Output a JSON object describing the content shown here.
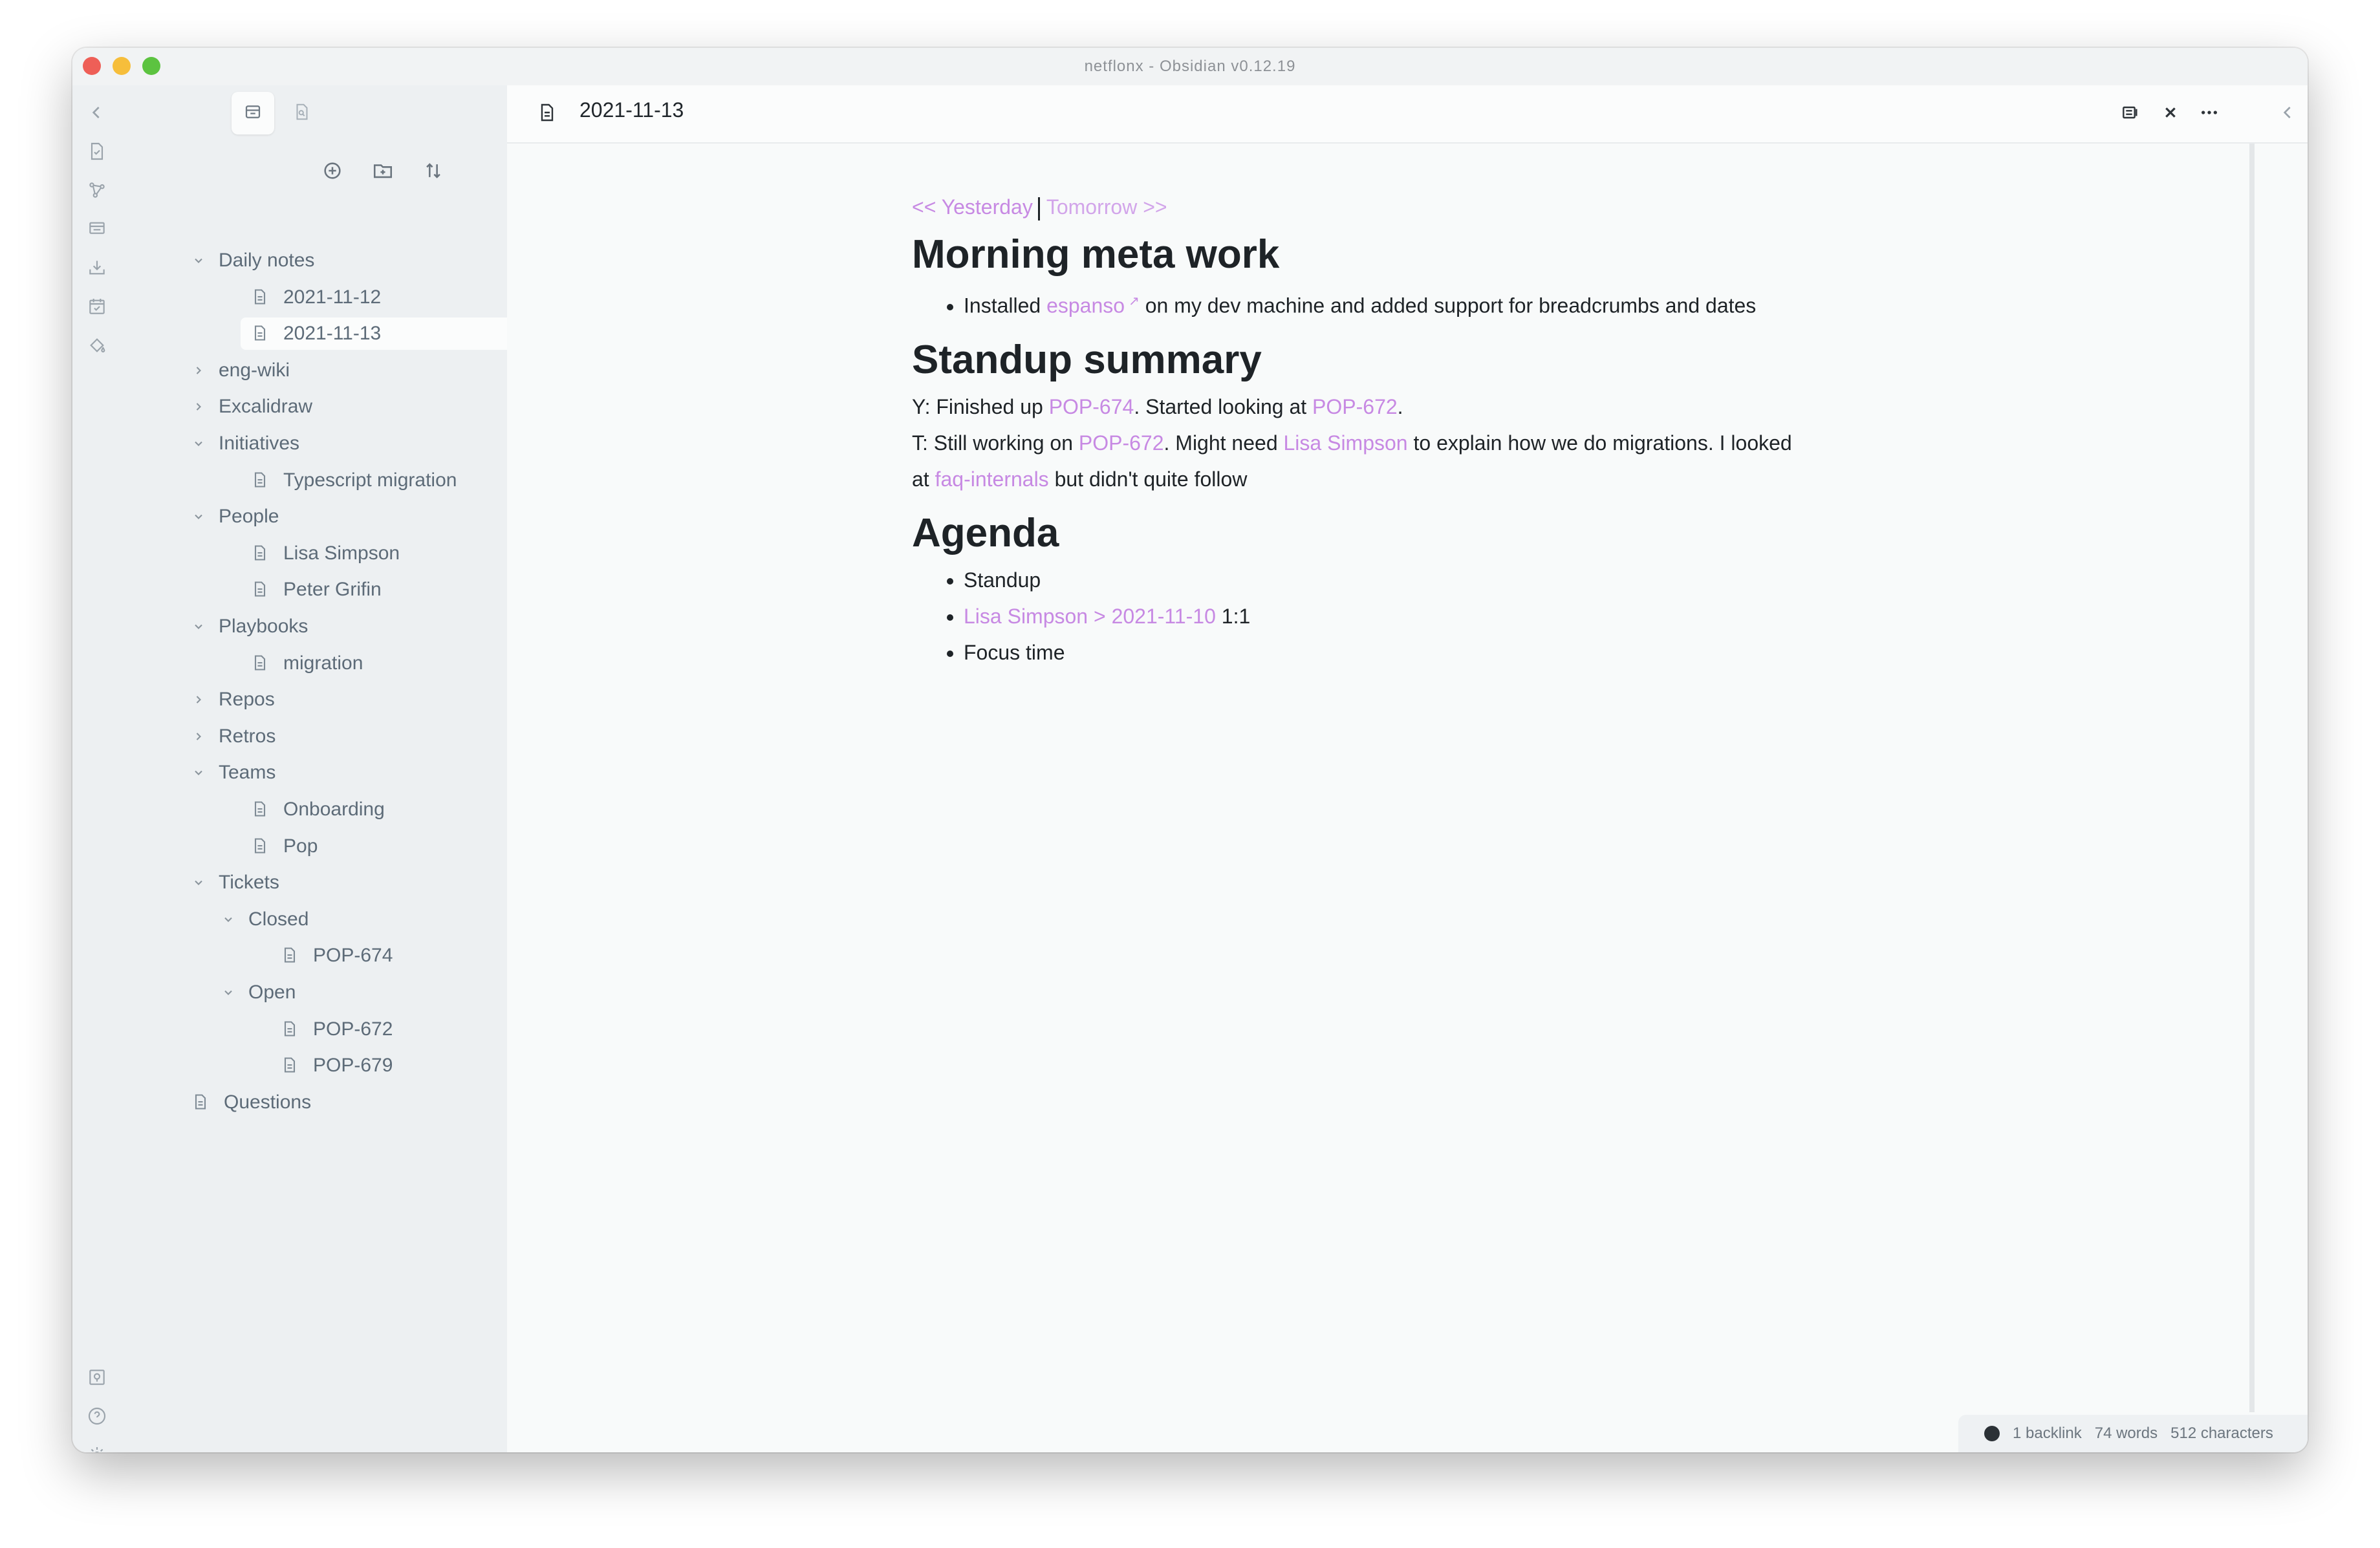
{
  "window": {
    "title": "netflonx - Obsidian v0.12.19"
  },
  "ribbon": {
    "icons": [
      "collapse-left-icon",
      "open-quick-switcher-icon",
      "graph-view-icon",
      "kanban-icon",
      "import-icon",
      "daily-note-icon",
      "paint-bucket-icon",
      "open-vault-icon",
      "help-icon",
      "settings-icon"
    ]
  },
  "sidebar": {
    "tabs": [
      "file-explorer-icon",
      "search-icon"
    ],
    "nav_actions": [
      "new-note-icon",
      "new-folder-icon",
      "sort-icon"
    ],
    "tree": [
      {
        "label": "Daily notes",
        "type": "folder",
        "expanded": true,
        "depth": 0
      },
      {
        "label": "2021-11-12",
        "type": "file",
        "depth": 1
      },
      {
        "label": "2021-11-13",
        "type": "file",
        "depth": 1,
        "selected": true
      },
      {
        "label": "eng-wiki",
        "type": "folder",
        "expanded": false,
        "depth": 0
      },
      {
        "label": "Excalidraw",
        "type": "folder",
        "expanded": false,
        "depth": 0
      },
      {
        "label": "Initiatives",
        "type": "folder",
        "expanded": true,
        "depth": 0
      },
      {
        "label": "Typescript migration",
        "type": "file",
        "depth": 1
      },
      {
        "label": "People",
        "type": "folder",
        "expanded": true,
        "depth": 0
      },
      {
        "label": "Lisa Simpson",
        "type": "file",
        "depth": 1
      },
      {
        "label": "Peter Grifin",
        "type": "file",
        "depth": 1
      },
      {
        "label": "Playbooks",
        "type": "folder",
        "expanded": true,
        "depth": 0
      },
      {
        "label": "migration",
        "type": "file",
        "depth": 1
      },
      {
        "label": "Repos",
        "type": "folder",
        "expanded": false,
        "depth": 0
      },
      {
        "label": "Retros",
        "type": "folder",
        "expanded": false,
        "depth": 0
      },
      {
        "label": "Teams",
        "type": "folder",
        "expanded": true,
        "depth": 0
      },
      {
        "label": "Onboarding",
        "type": "file",
        "depth": 1
      },
      {
        "label": "Pop",
        "type": "file",
        "depth": 1
      },
      {
        "label": "Tickets",
        "type": "folder",
        "expanded": true,
        "depth": 0
      },
      {
        "label": "Closed",
        "type": "folder",
        "expanded": true,
        "depth": 1
      },
      {
        "label": "POP-674",
        "type": "file",
        "depth": 2
      },
      {
        "label": "Open",
        "type": "folder",
        "expanded": true,
        "depth": 1
      },
      {
        "label": "POP-672",
        "type": "file",
        "depth": 2
      },
      {
        "label": "POP-679",
        "type": "file",
        "depth": 2
      },
      {
        "label": "Questions",
        "type": "file",
        "depth": 0
      }
    ]
  },
  "editor": {
    "tab_title": "2021-11-13",
    "actions": [
      "reading-mode-icon",
      "close-icon",
      "more-options-icon",
      "collapse-right-icon"
    ],
    "nav": {
      "yesterday": "<< Yesterday",
      "tomorrow": "Tomorrow >>"
    },
    "sections": {
      "morning": {
        "heading": "Morning meta work",
        "bullet_pre": "Installed ",
        "bullet_link": "espanso",
        "bullet_post": " on my dev machine and added support for breadcrumbs and dates"
      },
      "standup": {
        "heading": "Standup summary",
        "y_pre": "Y: Finished up ",
        "y_link1": "POP-674",
        "y_mid": ". Started looking at ",
        "y_link2": "POP-672",
        "y_post": ".",
        "t_pre": "T: Still working on ",
        "t_link1": "POP-672",
        "t_mid": ". Might need ",
        "t_link2": "Lisa Simpson",
        "t_mid2": " to explain how we do migrations. I looked at ",
        "t_link3": "faq-internals",
        "t_post": " but didn't quite follow"
      },
      "agenda": {
        "heading": "Agenda",
        "item1": "Standup",
        "item2_link": "Lisa Simpson > 2021-11-10",
        "item2_post": " 1:1",
        "item3": "Focus time"
      }
    }
  },
  "status": {
    "backlinks": "1 backlink",
    "words": "74 words",
    "characters": "512 characters"
  },
  "colors": {
    "accent": "#c789e3",
    "sidebar_bg": "#edf0f2",
    "editor_bg": "#f8fafa"
  }
}
